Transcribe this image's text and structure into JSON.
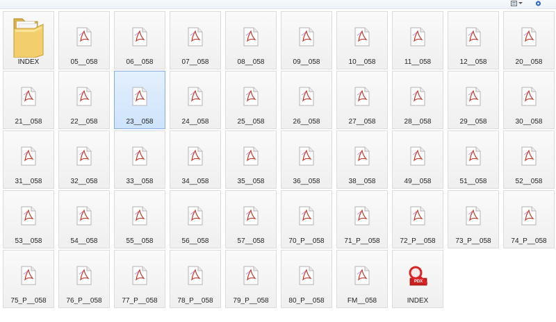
{
  "files": [
    {
      "name": "INDEX",
      "type": "folder"
    },
    {
      "name": "05__058",
      "type": "pdf"
    },
    {
      "name": "06__058",
      "type": "pdf"
    },
    {
      "name": "07__058",
      "type": "pdf"
    },
    {
      "name": "08__058",
      "type": "pdf"
    },
    {
      "name": "09__058",
      "type": "pdf"
    },
    {
      "name": "10__058",
      "type": "pdf"
    },
    {
      "name": "11__058",
      "type": "pdf"
    },
    {
      "name": "12__058",
      "type": "pdf"
    },
    {
      "name": "20__058",
      "type": "pdf"
    },
    {
      "name": "21__058",
      "type": "pdf"
    },
    {
      "name": "22__058",
      "type": "pdf"
    },
    {
      "name": "23__058",
      "type": "pdf",
      "selected": true
    },
    {
      "name": "24__058",
      "type": "pdf"
    },
    {
      "name": "25__058",
      "type": "pdf"
    },
    {
      "name": "26__058",
      "type": "pdf"
    },
    {
      "name": "27__058",
      "type": "pdf"
    },
    {
      "name": "28__058",
      "type": "pdf"
    },
    {
      "name": "29__058",
      "type": "pdf"
    },
    {
      "name": "30__058",
      "type": "pdf"
    },
    {
      "name": "31__058",
      "type": "pdf"
    },
    {
      "name": "32__058",
      "type": "pdf"
    },
    {
      "name": "33__058",
      "type": "pdf"
    },
    {
      "name": "34__058",
      "type": "pdf"
    },
    {
      "name": "35__058",
      "type": "pdf"
    },
    {
      "name": "36__058",
      "type": "pdf"
    },
    {
      "name": "38__058",
      "type": "pdf"
    },
    {
      "name": "49__058",
      "type": "pdf"
    },
    {
      "name": "51__058",
      "type": "pdf"
    },
    {
      "name": "52__058",
      "type": "pdf"
    },
    {
      "name": "53__058",
      "type": "pdf"
    },
    {
      "name": "54__058",
      "type": "pdf"
    },
    {
      "name": "55__058",
      "type": "pdf"
    },
    {
      "name": "56__058",
      "type": "pdf"
    },
    {
      "name": "57__058",
      "type": "pdf"
    },
    {
      "name": "70_P__058",
      "type": "pdf"
    },
    {
      "name": "71_P__058",
      "type": "pdf"
    },
    {
      "name": "72_P__058",
      "type": "pdf"
    },
    {
      "name": "73_P__058",
      "type": "pdf"
    },
    {
      "name": "74_P__058",
      "type": "pdf"
    },
    {
      "name": "75_P__058",
      "type": "pdf"
    },
    {
      "name": "76_P__058",
      "type": "pdf"
    },
    {
      "name": "77_P__058",
      "type": "pdf"
    },
    {
      "name": "78_P__058",
      "type": "pdf"
    },
    {
      "name": "79_P__058",
      "type": "pdf"
    },
    {
      "name": "80_P__058",
      "type": "pdf"
    },
    {
      "name": "FM__058",
      "type": "pdf"
    },
    {
      "name": "INDEX",
      "type": "pdx",
      "badge": "PDX"
    }
  ],
  "icons": {
    "folder": "folder-icon",
    "pdf": "pdf-file-icon",
    "pdx": "pdx-index-icon",
    "views": "views-icon",
    "help": "help-icon"
  },
  "colors": {
    "selection_fill": "#cde3fb",
    "selection_border": "#84acdd",
    "tile_border": "#dcdcdc",
    "acrobat_red": "#d32f2f",
    "pdx_badge": "#cc1f1f"
  }
}
